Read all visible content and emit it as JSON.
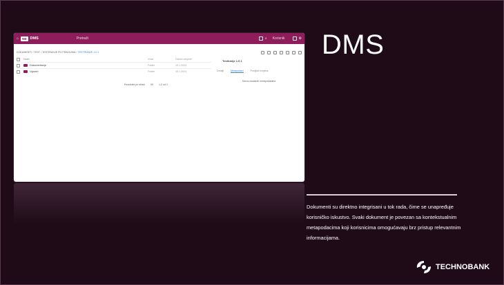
{
  "app": {
    "name": "DMS",
    "logo_text": "NB",
    "search_placeholder": "Pretraži",
    "user_text": "Korisnik"
  },
  "breadcrumb": [
    "DOKUMENTI",
    "TEST",
    "TESTIRANJE PO PRAVILIMA",
    "TESTIRANJE 1.0.1"
  ],
  "list": {
    "headers": {
      "name": "Naziv",
      "type": "Vrsta",
      "date": "Datum izmjene"
    },
    "rows": [
      {
        "name": "Dokumentacija",
        "type": "Folder",
        "date": "10.1.2024"
      },
      {
        "name": "Ugovori",
        "type": "Folder",
        "date": "10.1.2024"
      }
    ],
    "pager": {
      "label": "Rezultata po strani",
      "per_page": "50",
      "range": "1-2 od 2"
    }
  },
  "side_panel": {
    "title": "Testiranje 1.0.1",
    "tabs": [
      "Detalji",
      "Metapodaci",
      "Povijest izmjena"
    ],
    "empty_text": "Nema dodatnih metapodataka"
  },
  "slide": {
    "headline": "DMS",
    "description": "Dokumenti su direktno integrisani u tok rada, čime se unapređuje korisničko iskustvo. Svaki dokument je povezan sa kontekstualnim metapodacima koji korisnicima omogućavaju brz pristup relevantnim informacijama.",
    "brand": "TECHNOBANK"
  },
  "colors": {
    "accent": "#8f1d5c",
    "background": "#1e0b17",
    "link": "#3f7fd4"
  }
}
